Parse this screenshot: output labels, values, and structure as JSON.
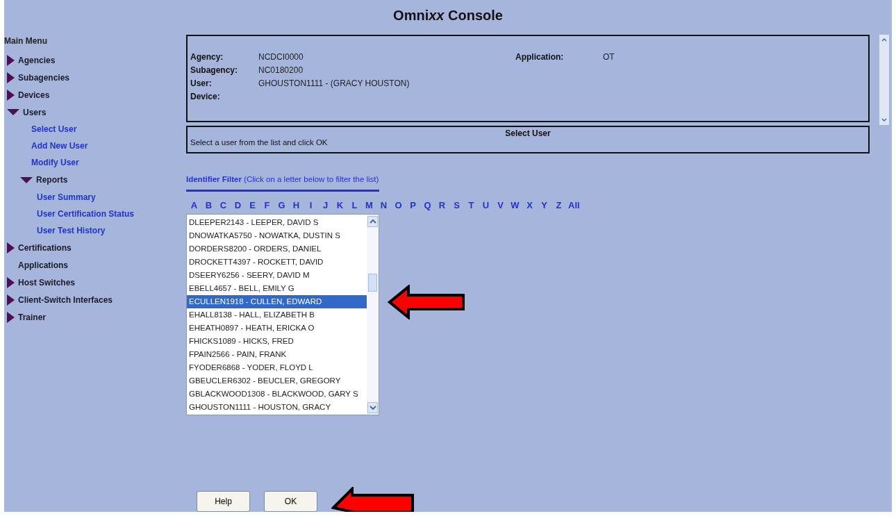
{
  "title": {
    "lead": "Omni",
    "italic": "xx",
    "rest": " Console"
  },
  "sidebar": {
    "heading": "Main Menu",
    "items": [
      {
        "label": "Agencies",
        "kind": "group",
        "expanded": false
      },
      {
        "label": "Subagencies",
        "kind": "group",
        "expanded": false
      },
      {
        "label": "Devices",
        "kind": "group",
        "expanded": false
      },
      {
        "label": "Users",
        "kind": "group",
        "expanded": true,
        "children": [
          {
            "label": "Select User",
            "kind": "link"
          },
          {
            "label": "Add New User",
            "kind": "link"
          },
          {
            "label": "Modify User",
            "kind": "link"
          },
          {
            "label": "Reports",
            "kind": "group",
            "expanded": true,
            "children": [
              {
                "label": "User Summary",
                "kind": "link"
              },
              {
                "label": "User Certification Status",
                "kind": "link"
              },
              {
                "label": "User Test History",
                "kind": "link"
              }
            ]
          }
        ]
      },
      {
        "label": "Certifications",
        "kind": "group",
        "expanded": false
      },
      {
        "label": "Applications",
        "kind": "plain"
      },
      {
        "label": "Host Switches",
        "kind": "group",
        "expanded": false
      },
      {
        "label": "Client-Switch Interfaces",
        "kind": "group",
        "expanded": false
      },
      {
        "label": "Trainer",
        "kind": "group",
        "expanded": false
      }
    ]
  },
  "info": {
    "fields": [
      {
        "label": "Agency:",
        "value": "NCDCI0000"
      },
      {
        "label": "Subagency:",
        "value": "NC0180200"
      },
      {
        "label": "User:",
        "value": "GHOUSTON1111 - (GRACY HOUSTON)"
      },
      {
        "label": "Device:"
      }
    ],
    "application": {
      "label": "Application:",
      "value": "OT"
    }
  },
  "section": {
    "title": "Select User",
    "instruction": "Select a user from the list and click OK"
  },
  "filter": {
    "label": "Identifier Filter",
    "hint": "(Click on a letter below to filter the list)",
    "letters": [
      "A",
      "B",
      "C",
      "D",
      "E",
      "F",
      "G",
      "H",
      "I",
      "J",
      "K",
      "L",
      "M",
      "N",
      "O",
      "P",
      "Q",
      "R",
      "S",
      "T",
      "U",
      "V",
      "W",
      "X",
      "Y",
      "Z",
      "All"
    ]
  },
  "users": [
    {
      "text": "DLEEPER2143 - LEEPER, DAVID S",
      "selected": false
    },
    {
      "text": "DNOWATKA5750 - NOWATKA, DUSTIN S",
      "selected": false
    },
    {
      "text": "DORDERS8200 - ORDERS, DANIEL",
      "selected": false
    },
    {
      "text": "DROCKETT4397 - ROCKETT, DAVID",
      "selected": false
    },
    {
      "text": "DSEERY6256 - SEERY, DAVID M",
      "selected": false
    },
    {
      "text": "EBELL4657 - BELL, EMILY G",
      "selected": false
    },
    {
      "text": "ECULLEN1918 - CULLEN, EDWARD",
      "selected": true
    },
    {
      "text": "EHALL8138 - HALL, ELIZABETH B",
      "selected": false
    },
    {
      "text": "EHEATH0897 - HEATH, ERICKA O",
      "selected": false
    },
    {
      "text": "FHICKS1089 - HICKS, FRED",
      "selected": false
    },
    {
      "text": "FPAIN2566 - PAIN, FRANK",
      "selected": false
    },
    {
      "text": "FYODER6868 - YODER, FLOYD L",
      "selected": false
    },
    {
      "text": "GBEUCLER6302 - BEUCLER, GREGORY",
      "selected": false
    },
    {
      "text": "GBLACKWOOD1308 - BLACKWOOD, GARY S",
      "selected": false
    },
    {
      "text": "GHOUSTON1111 - HOUSTON, GRACY",
      "selected": false
    }
  ],
  "buttons": [
    "Help",
    "OK"
  ]
}
